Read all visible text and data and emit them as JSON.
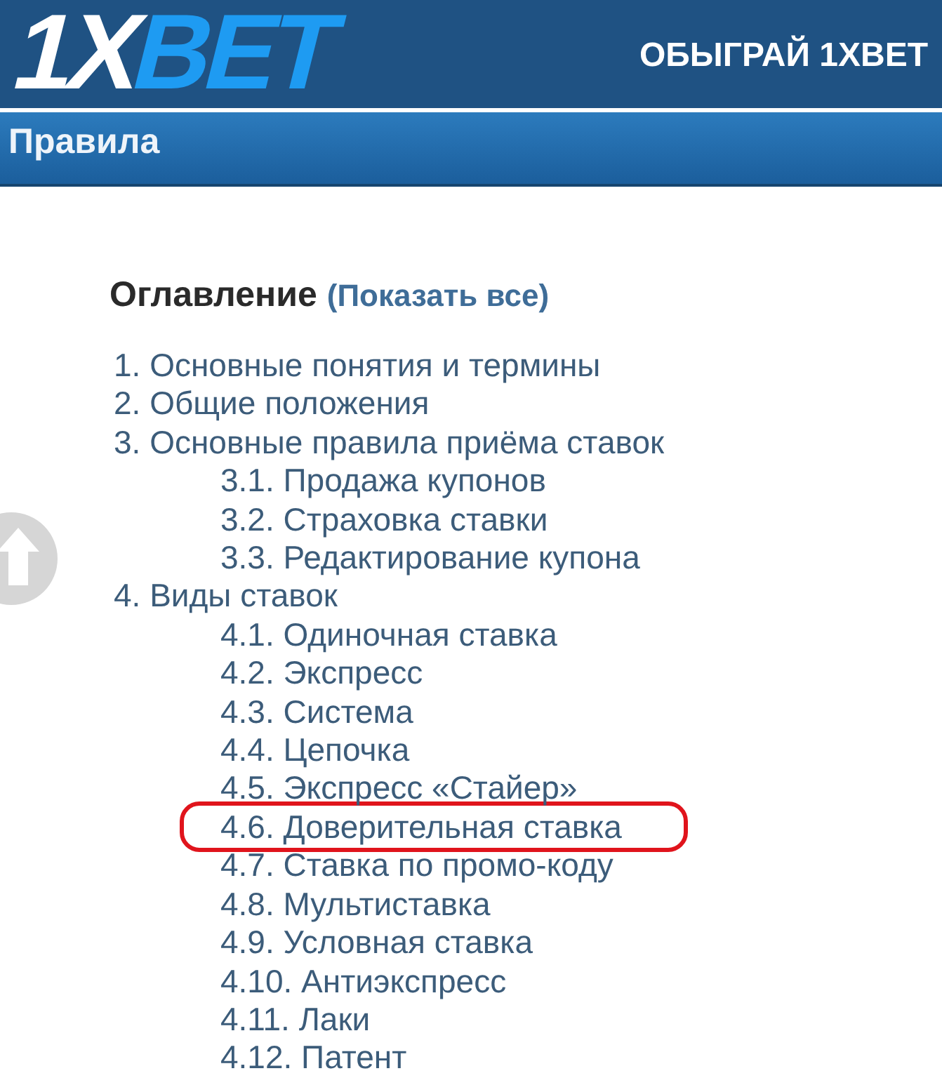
{
  "header": {
    "logo": {
      "part_1": "1X",
      "part_2": "BET"
    },
    "promo_link": "ОБЫГРАЙ 1XBET"
  },
  "title_bar": {
    "title": "Правила"
  },
  "contents": {
    "heading": "Оглавление",
    "show_all_link": "(Показать все)",
    "items": [
      {
        "label": "1. Основные понятия и термины",
        "highlighted": false
      },
      {
        "label": "2. Общие положения",
        "highlighted": false
      },
      {
        "label": "3. Основные правила приёма ставок",
        "highlighted": false,
        "children": [
          {
            "label": "3.1. Продажа купонов",
            "highlighted": false
          },
          {
            "label": "3.2. Страховка ставки",
            "highlighted": false
          },
          {
            "label": "3.3. Редактирование купона",
            "highlighted": false
          }
        ]
      },
      {
        "label": "4. Виды ставок",
        "highlighted": false,
        "children": [
          {
            "label": "4.1. Одиночная ставка",
            "highlighted": false
          },
          {
            "label": "4.2. Экспресс",
            "highlighted": false
          },
          {
            "label": "4.3. Система",
            "highlighted": false
          },
          {
            "label": "4.4. Цепочка",
            "highlighted": false
          },
          {
            "label": "4.5. Экспресс «Стайер»",
            "highlighted": false
          },
          {
            "label": "4.6. Доверительная ставка",
            "highlighted": true
          },
          {
            "label": "4.7. Ставка по промо-коду",
            "highlighted": false
          },
          {
            "label": "4.8. Мультиставка",
            "highlighted": false
          },
          {
            "label": "4.9. Условная ставка",
            "highlighted": false
          },
          {
            "label": "4.10. Антиэкспресс",
            "highlighted": false
          },
          {
            "label": "4.11. Лаки",
            "highlighted": false
          },
          {
            "label": "4.12. Патент",
            "highlighted": false
          }
        ]
      }
    ]
  }
}
